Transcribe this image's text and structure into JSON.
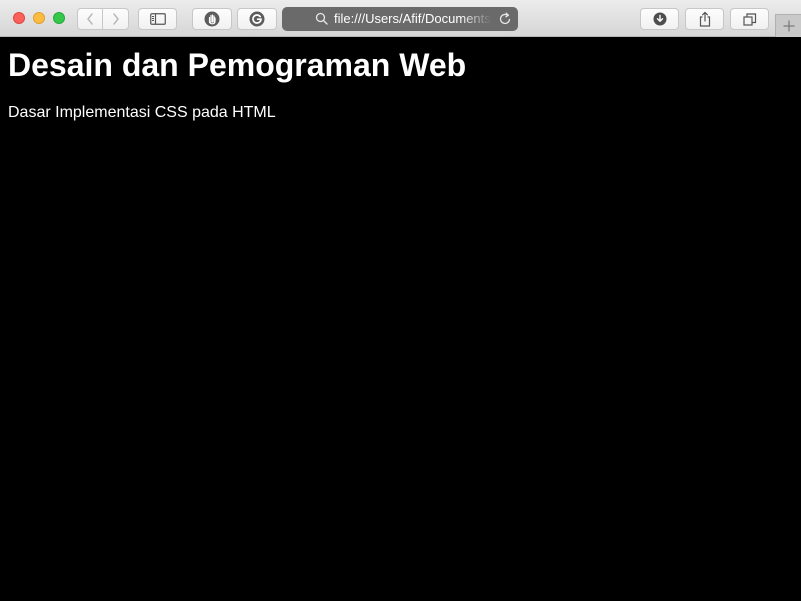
{
  "browser": {
    "address_bar": {
      "url": "file:///Users/Afif/Documents"
    }
  },
  "page": {
    "heading": "Desain dan Pemograman Web",
    "paragraph": "Dasar Implementasi CSS pada HTML",
    "background_color": "#000000",
    "text_color": "#ffffff"
  },
  "icons": {
    "close": "red-close-icon",
    "minimize": "yellow-minimize-icon",
    "zoom": "green-zoom-icon",
    "back": "chevron-left-icon",
    "forward": "chevron-right-icon",
    "sidebar": "sidebar-icon",
    "extension_1": "hand-extension-icon",
    "extension_2": "grammarly-extension-icon",
    "search": "search-icon",
    "reload": "reload-icon",
    "download": "download-icon",
    "share": "share-icon",
    "tabs": "tab-overview-icon",
    "new_tab": "plus-icon"
  }
}
